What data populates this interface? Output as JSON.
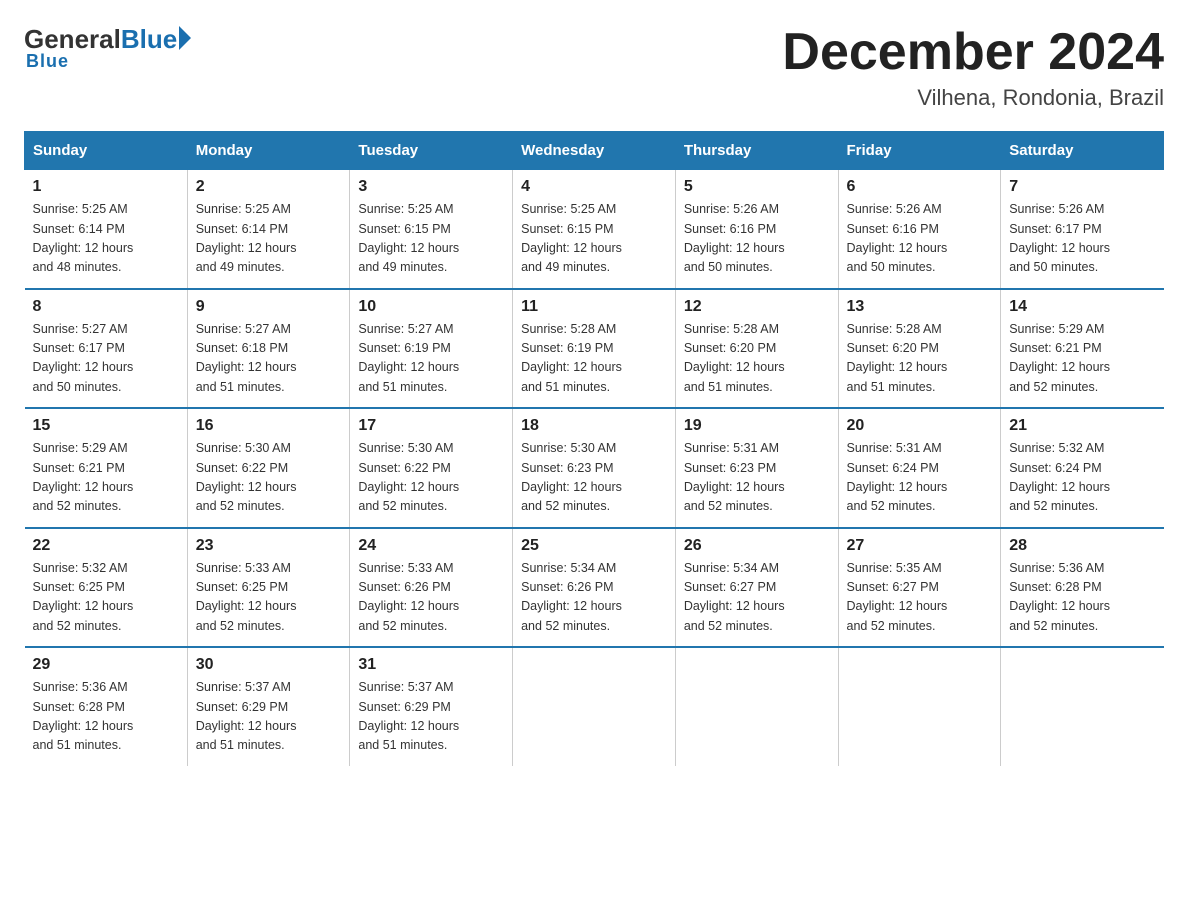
{
  "header": {
    "logo_general": "General",
    "logo_blue": "Blue",
    "month_title": "December 2024",
    "location": "Vilhena, Rondonia, Brazil"
  },
  "weekdays": [
    "Sunday",
    "Monday",
    "Tuesday",
    "Wednesday",
    "Thursday",
    "Friday",
    "Saturday"
  ],
  "weeks": [
    [
      {
        "day": "1",
        "sunrise": "5:25 AM",
        "sunset": "6:14 PM",
        "daylight": "12 hours and 48 minutes."
      },
      {
        "day": "2",
        "sunrise": "5:25 AM",
        "sunset": "6:14 PM",
        "daylight": "12 hours and 49 minutes."
      },
      {
        "day": "3",
        "sunrise": "5:25 AM",
        "sunset": "6:15 PM",
        "daylight": "12 hours and 49 minutes."
      },
      {
        "day": "4",
        "sunrise": "5:25 AM",
        "sunset": "6:15 PM",
        "daylight": "12 hours and 49 minutes."
      },
      {
        "day": "5",
        "sunrise": "5:26 AM",
        "sunset": "6:16 PM",
        "daylight": "12 hours and 50 minutes."
      },
      {
        "day": "6",
        "sunrise": "5:26 AM",
        "sunset": "6:16 PM",
        "daylight": "12 hours and 50 minutes."
      },
      {
        "day": "7",
        "sunrise": "5:26 AM",
        "sunset": "6:17 PM",
        "daylight": "12 hours and 50 minutes."
      }
    ],
    [
      {
        "day": "8",
        "sunrise": "5:27 AM",
        "sunset": "6:17 PM",
        "daylight": "12 hours and 50 minutes."
      },
      {
        "day": "9",
        "sunrise": "5:27 AM",
        "sunset": "6:18 PM",
        "daylight": "12 hours and 51 minutes."
      },
      {
        "day": "10",
        "sunrise": "5:27 AM",
        "sunset": "6:19 PM",
        "daylight": "12 hours and 51 minutes."
      },
      {
        "day": "11",
        "sunrise": "5:28 AM",
        "sunset": "6:19 PM",
        "daylight": "12 hours and 51 minutes."
      },
      {
        "day": "12",
        "sunrise": "5:28 AM",
        "sunset": "6:20 PM",
        "daylight": "12 hours and 51 minutes."
      },
      {
        "day": "13",
        "sunrise": "5:28 AM",
        "sunset": "6:20 PM",
        "daylight": "12 hours and 51 minutes."
      },
      {
        "day": "14",
        "sunrise": "5:29 AM",
        "sunset": "6:21 PM",
        "daylight": "12 hours and 52 minutes."
      }
    ],
    [
      {
        "day": "15",
        "sunrise": "5:29 AM",
        "sunset": "6:21 PM",
        "daylight": "12 hours and 52 minutes."
      },
      {
        "day": "16",
        "sunrise": "5:30 AM",
        "sunset": "6:22 PM",
        "daylight": "12 hours and 52 minutes."
      },
      {
        "day": "17",
        "sunrise": "5:30 AM",
        "sunset": "6:22 PM",
        "daylight": "12 hours and 52 minutes."
      },
      {
        "day": "18",
        "sunrise": "5:30 AM",
        "sunset": "6:23 PM",
        "daylight": "12 hours and 52 minutes."
      },
      {
        "day": "19",
        "sunrise": "5:31 AM",
        "sunset": "6:23 PM",
        "daylight": "12 hours and 52 minutes."
      },
      {
        "day": "20",
        "sunrise": "5:31 AM",
        "sunset": "6:24 PM",
        "daylight": "12 hours and 52 minutes."
      },
      {
        "day": "21",
        "sunrise": "5:32 AM",
        "sunset": "6:24 PM",
        "daylight": "12 hours and 52 minutes."
      }
    ],
    [
      {
        "day": "22",
        "sunrise": "5:32 AM",
        "sunset": "6:25 PM",
        "daylight": "12 hours and 52 minutes."
      },
      {
        "day": "23",
        "sunrise": "5:33 AM",
        "sunset": "6:25 PM",
        "daylight": "12 hours and 52 minutes."
      },
      {
        "day": "24",
        "sunrise": "5:33 AM",
        "sunset": "6:26 PM",
        "daylight": "12 hours and 52 minutes."
      },
      {
        "day": "25",
        "sunrise": "5:34 AM",
        "sunset": "6:26 PM",
        "daylight": "12 hours and 52 minutes."
      },
      {
        "day": "26",
        "sunrise": "5:34 AM",
        "sunset": "6:27 PM",
        "daylight": "12 hours and 52 minutes."
      },
      {
        "day": "27",
        "sunrise": "5:35 AM",
        "sunset": "6:27 PM",
        "daylight": "12 hours and 52 minutes."
      },
      {
        "day": "28",
        "sunrise": "5:36 AM",
        "sunset": "6:28 PM",
        "daylight": "12 hours and 52 minutes."
      }
    ],
    [
      {
        "day": "29",
        "sunrise": "5:36 AM",
        "sunset": "6:28 PM",
        "daylight": "12 hours and 51 minutes."
      },
      {
        "day": "30",
        "sunrise": "5:37 AM",
        "sunset": "6:29 PM",
        "daylight": "12 hours and 51 minutes."
      },
      {
        "day": "31",
        "sunrise": "5:37 AM",
        "sunset": "6:29 PM",
        "daylight": "12 hours and 51 minutes."
      },
      null,
      null,
      null,
      null
    ]
  ],
  "labels": {
    "sunrise": "Sunrise:",
    "sunset": "Sunset:",
    "daylight": "Daylight:"
  }
}
